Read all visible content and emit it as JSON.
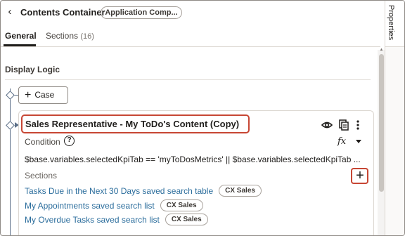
{
  "header": {
    "back_icon": "chevron-left-icon",
    "title": "Contents Container",
    "chip": "Application Comp..."
  },
  "tabs": [
    {
      "label": "General",
      "active": true
    },
    {
      "label": "Sections",
      "count": "(16)"
    }
  ],
  "side_panel": {
    "label": "Properties"
  },
  "display_logic": {
    "heading": "Display Logic",
    "add_case_label": "Case"
  },
  "card": {
    "title": "Sales Representative - My ToDo's Content (Copy)",
    "condition_label": "Condition",
    "help_glyph": "?",
    "fx_label": "fx",
    "expression": "$base.variables.selectedKpiTab == 'myToDosMetrics' || $base.variables.selectedKpiTab ...",
    "sections_label": "Sections",
    "sections": [
      {
        "label": "Tasks Due in the Next 30 Days saved search table",
        "badge": "CX Sales"
      },
      {
        "label": "My Appointments saved search list",
        "badge": "CX Sales"
      },
      {
        "label": "My Overdue Tasks saved search list",
        "badge": "CX Sales"
      }
    ]
  },
  "colors": {
    "highlight": "#c74634",
    "link": "#2b6d9c",
    "tree_line": "#5b6e87"
  }
}
